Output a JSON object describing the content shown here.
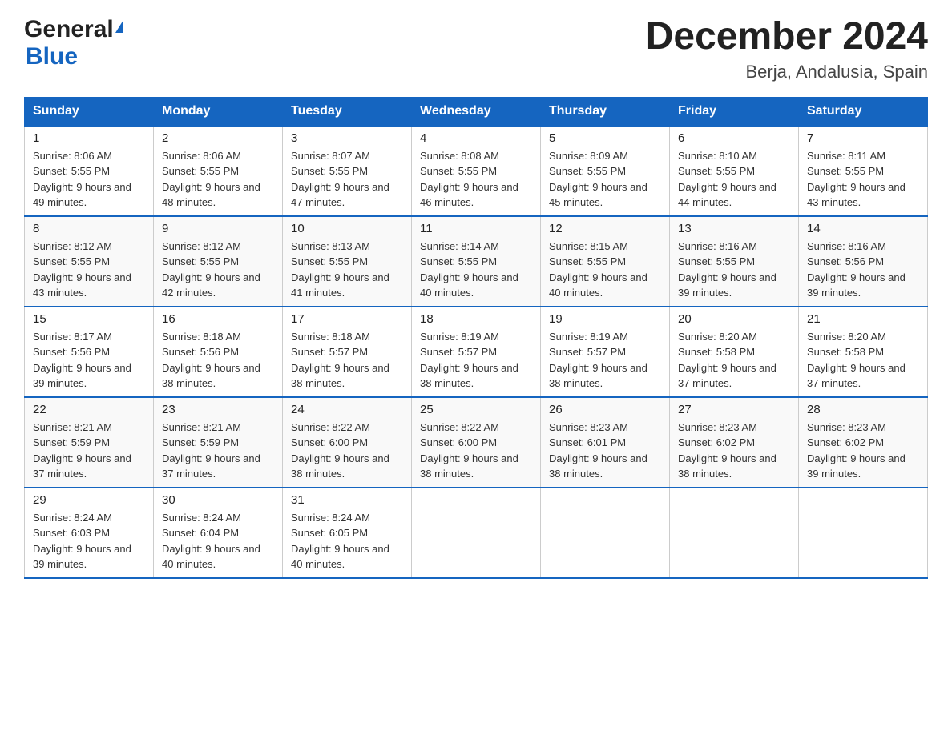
{
  "header": {
    "logo_general": "General",
    "logo_blue": "Blue",
    "title": "December 2024",
    "location": "Berja, Andalusia, Spain"
  },
  "days_of_week": [
    "Sunday",
    "Monday",
    "Tuesday",
    "Wednesday",
    "Thursday",
    "Friday",
    "Saturday"
  ],
  "weeks": [
    [
      {
        "day": "1",
        "sunrise": "8:06 AM",
        "sunset": "5:55 PM",
        "daylight": "9 hours and 49 minutes."
      },
      {
        "day": "2",
        "sunrise": "8:06 AM",
        "sunset": "5:55 PM",
        "daylight": "9 hours and 48 minutes."
      },
      {
        "day": "3",
        "sunrise": "8:07 AM",
        "sunset": "5:55 PM",
        "daylight": "9 hours and 47 minutes."
      },
      {
        "day": "4",
        "sunrise": "8:08 AM",
        "sunset": "5:55 PM",
        "daylight": "9 hours and 46 minutes."
      },
      {
        "day": "5",
        "sunrise": "8:09 AM",
        "sunset": "5:55 PM",
        "daylight": "9 hours and 45 minutes."
      },
      {
        "day": "6",
        "sunrise": "8:10 AM",
        "sunset": "5:55 PM",
        "daylight": "9 hours and 44 minutes."
      },
      {
        "day": "7",
        "sunrise": "8:11 AM",
        "sunset": "5:55 PM",
        "daylight": "9 hours and 43 minutes."
      }
    ],
    [
      {
        "day": "8",
        "sunrise": "8:12 AM",
        "sunset": "5:55 PM",
        "daylight": "9 hours and 43 minutes."
      },
      {
        "day": "9",
        "sunrise": "8:12 AM",
        "sunset": "5:55 PM",
        "daylight": "9 hours and 42 minutes."
      },
      {
        "day": "10",
        "sunrise": "8:13 AM",
        "sunset": "5:55 PM",
        "daylight": "9 hours and 41 minutes."
      },
      {
        "day": "11",
        "sunrise": "8:14 AM",
        "sunset": "5:55 PM",
        "daylight": "9 hours and 40 minutes."
      },
      {
        "day": "12",
        "sunrise": "8:15 AM",
        "sunset": "5:55 PM",
        "daylight": "9 hours and 40 minutes."
      },
      {
        "day": "13",
        "sunrise": "8:16 AM",
        "sunset": "5:55 PM",
        "daylight": "9 hours and 39 minutes."
      },
      {
        "day": "14",
        "sunrise": "8:16 AM",
        "sunset": "5:56 PM",
        "daylight": "9 hours and 39 minutes."
      }
    ],
    [
      {
        "day": "15",
        "sunrise": "8:17 AM",
        "sunset": "5:56 PM",
        "daylight": "9 hours and 39 minutes."
      },
      {
        "day": "16",
        "sunrise": "8:18 AM",
        "sunset": "5:56 PM",
        "daylight": "9 hours and 38 minutes."
      },
      {
        "day": "17",
        "sunrise": "8:18 AM",
        "sunset": "5:57 PM",
        "daylight": "9 hours and 38 minutes."
      },
      {
        "day": "18",
        "sunrise": "8:19 AM",
        "sunset": "5:57 PM",
        "daylight": "9 hours and 38 minutes."
      },
      {
        "day": "19",
        "sunrise": "8:19 AM",
        "sunset": "5:57 PM",
        "daylight": "9 hours and 38 minutes."
      },
      {
        "day": "20",
        "sunrise": "8:20 AM",
        "sunset": "5:58 PM",
        "daylight": "9 hours and 37 minutes."
      },
      {
        "day": "21",
        "sunrise": "8:20 AM",
        "sunset": "5:58 PM",
        "daylight": "9 hours and 37 minutes."
      }
    ],
    [
      {
        "day": "22",
        "sunrise": "8:21 AM",
        "sunset": "5:59 PM",
        "daylight": "9 hours and 37 minutes."
      },
      {
        "day": "23",
        "sunrise": "8:21 AM",
        "sunset": "5:59 PM",
        "daylight": "9 hours and 37 minutes."
      },
      {
        "day": "24",
        "sunrise": "8:22 AM",
        "sunset": "6:00 PM",
        "daylight": "9 hours and 38 minutes."
      },
      {
        "day": "25",
        "sunrise": "8:22 AM",
        "sunset": "6:00 PM",
        "daylight": "9 hours and 38 minutes."
      },
      {
        "day": "26",
        "sunrise": "8:23 AM",
        "sunset": "6:01 PM",
        "daylight": "9 hours and 38 minutes."
      },
      {
        "day": "27",
        "sunrise": "8:23 AM",
        "sunset": "6:02 PM",
        "daylight": "9 hours and 38 minutes."
      },
      {
        "day": "28",
        "sunrise": "8:23 AM",
        "sunset": "6:02 PM",
        "daylight": "9 hours and 39 minutes."
      }
    ],
    [
      {
        "day": "29",
        "sunrise": "8:24 AM",
        "sunset": "6:03 PM",
        "daylight": "9 hours and 39 minutes."
      },
      {
        "day": "30",
        "sunrise": "8:24 AM",
        "sunset": "6:04 PM",
        "daylight": "9 hours and 40 minutes."
      },
      {
        "day": "31",
        "sunrise": "8:24 AM",
        "sunset": "6:05 PM",
        "daylight": "9 hours and 40 minutes."
      },
      null,
      null,
      null,
      null
    ]
  ]
}
